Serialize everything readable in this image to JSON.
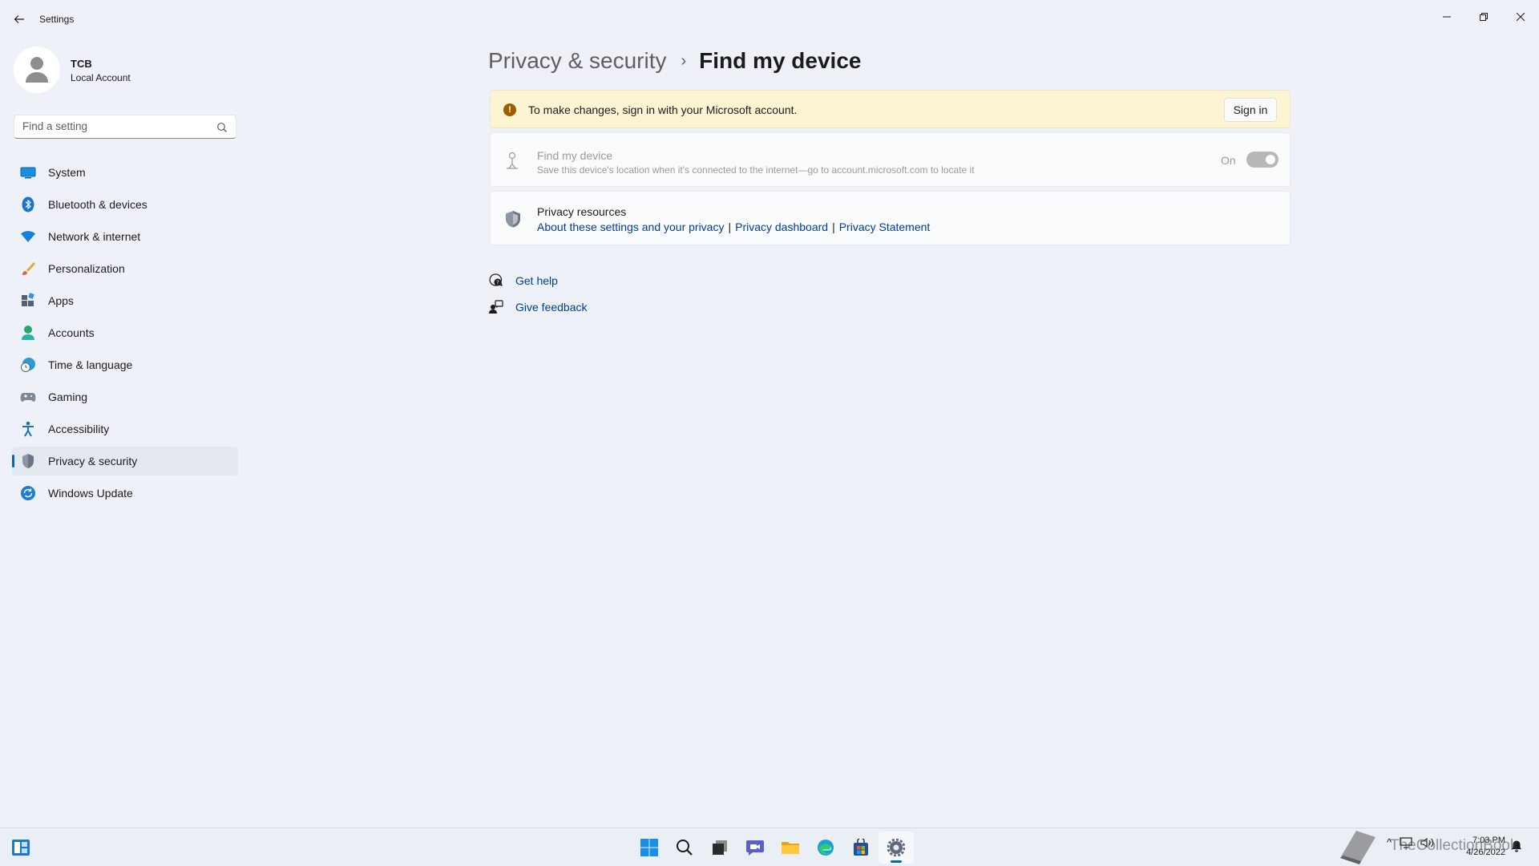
{
  "window": {
    "title": "Settings"
  },
  "user": {
    "name": "TCB",
    "account_type": "Local Account"
  },
  "search": {
    "placeholder": "Find a setting"
  },
  "sidebar": {
    "items": [
      {
        "label": "System",
        "icon": "monitor-icon"
      },
      {
        "label": "Bluetooth & devices",
        "icon": "bluetooth-icon"
      },
      {
        "label": "Network & internet",
        "icon": "wifi-icon"
      },
      {
        "label": "Personalization",
        "icon": "brush-icon"
      },
      {
        "label": "Apps",
        "icon": "apps-icon"
      },
      {
        "label": "Accounts",
        "icon": "person-icon"
      },
      {
        "label": "Time & language",
        "icon": "globe-clock-icon"
      },
      {
        "label": "Gaming",
        "icon": "gamepad-icon"
      },
      {
        "label": "Accessibility",
        "icon": "accessibility-icon"
      },
      {
        "label": "Privacy & security",
        "icon": "shield-icon",
        "selected": true
      },
      {
        "label": "Windows Update",
        "icon": "update-icon"
      }
    ]
  },
  "breadcrumb": {
    "parent": "Privacy & security",
    "separator": "›",
    "current": "Find my device"
  },
  "banner": {
    "text": "To make changes, sign in with your Microsoft account.",
    "button": "Sign in"
  },
  "find_my_device": {
    "title": "Find my device",
    "description": "Save this device's location when it's connected to the internet—go to account.microsoft.com to locate it",
    "state_label": "On",
    "enabled": true,
    "disabled": true
  },
  "privacy_resources": {
    "title": "Privacy resources",
    "links": [
      "About these settings and your privacy",
      "Privacy dashboard",
      "Privacy Statement"
    ],
    "separator": "|"
  },
  "help": {
    "get_help": "Get help",
    "give_feedback": "Give feedback"
  },
  "taskbar": {
    "apps": [
      "start-icon",
      "search-icon",
      "task-view-icon",
      "chat-icon",
      "file-explorer-icon",
      "edge-icon",
      "store-icon",
      "settings-icon"
    ],
    "active_app": "settings-icon",
    "time": "7:03 PM",
    "date": "4/26/2022",
    "tray_chevron": "^"
  },
  "watermark": {
    "text": "TheCollectionBook"
  },
  "colors": {
    "accent": "#0067c0",
    "link": "#003e92",
    "warning": "#9d5d00",
    "banner_bg": "#fcf4d3"
  }
}
